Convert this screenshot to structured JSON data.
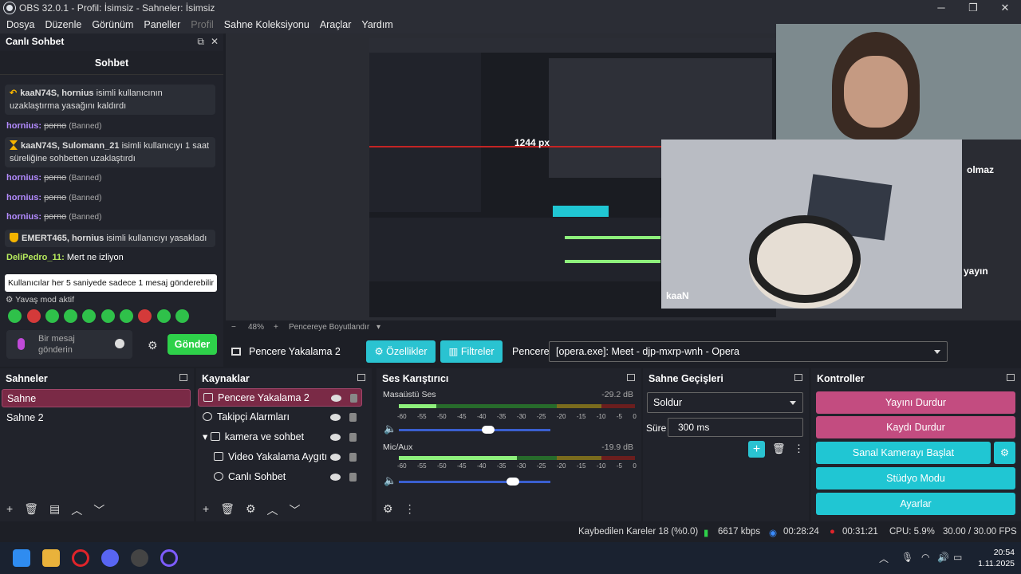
{
  "window": {
    "title": "OBS 32.0.1 - Profil: İsimsiz - Sahneler: İsimsiz"
  },
  "menu": [
    "Dosya",
    "Düzenle",
    "Görünüm",
    "Paneller",
    "Profil",
    "Sahne Koleksiyonu",
    "Araçlar",
    "Yardım"
  ],
  "chat": {
    "dock_title": "Canlı Sohbet",
    "tab": "Sohbet",
    "messages": [
      {
        "user": "kaaN74S, hornius",
        "text": "isimli kullanıcının uzaklaştırma yasağını kaldırdı"
      },
      {
        "user": "hornius:",
        "text": "porno",
        "tag": "(Banned)"
      },
      {
        "user": "kaaN74S, Sulomann_21",
        "text": "isimli kullanıcıyı 1 saat süreliğine sohbetten uzaklaştırdı"
      },
      {
        "user": "hornius:",
        "text": "porno",
        "tag": "(Banned)"
      },
      {
        "user": "hornius:",
        "text": "porno",
        "tag": "(Banned)"
      },
      {
        "user": "hornius:",
        "text": "porno",
        "tag": "(Banned)"
      },
      {
        "user": "EMERT465, hornius",
        "text": "isimli kullanıcıyı yasakladı"
      },
      {
        "user": "DeliPedro_11:",
        "text": "Mert ne izliyon"
      }
    ],
    "slow_notice": "Kullanıcılar her 5 saniyede sadece 1 mesaj gönderebilir",
    "slow_mode": "Yavaş mod aktif",
    "placeholder": "Bir mesaj gönderin",
    "send": "Gönder"
  },
  "preview": {
    "px_label": "1244 px",
    "cam_name": "kaaN",
    "overlay_text_1": "olmaz",
    "overlay_text_2": "yayın",
    "zoom": "48%",
    "fit": "Pencereye Boyutlandır"
  },
  "source_bar": {
    "source": "Pencere Yakalama 2",
    "properties": "Özellikler",
    "filters": "Filtreler",
    "window_label": "Pencere",
    "window_value": "[opera.exe]: Meet - djp-mxrp-wnh - Opera"
  },
  "scenes": {
    "title": "Sahneler",
    "items": [
      "Sahne",
      "Sahne 2"
    ]
  },
  "sources": {
    "title": "Kaynaklar",
    "items": [
      "Pencere Yakalama 2",
      "Takipçi Alarmları",
      "kamera ve sohbet",
      "Video Yakalama Aygıtı",
      "Canlı Sohbet"
    ]
  },
  "mixer": {
    "title": "Ses Karıştırıcı",
    "channels": [
      {
        "name": "Masaüstü Ses",
        "db": "-29.2 dB",
        "level": 0.16,
        "volume": 0.59
      },
      {
        "name": "Mic/Aux",
        "db": "-19.9 dB",
        "level": 0.5,
        "volume": 0.75
      }
    ],
    "ticks": [
      "-60",
      "-55",
      "-50",
      "-45",
      "-40",
      "-35",
      "-30",
      "-25",
      "-20",
      "-15",
      "-10",
      "-5",
      "0"
    ]
  },
  "transitions": {
    "title": "Sahne Geçişleri",
    "type": "Soldur",
    "duration_label": "Süre",
    "duration": "300 ms"
  },
  "controls": {
    "title": "Kontroller",
    "stop_stream": "Yayını Durdur",
    "stop_rec": "Kaydı Durdur",
    "virtual_cam": "Sanal Kamerayı Başlat",
    "studio": "Stüdyo Modu",
    "settings": "Ayarlar"
  },
  "status": {
    "dropped": "Kaybedilen Kareler 18 (%0.0)",
    "bitrate": "6617 kbps",
    "stream_time": "00:28:24",
    "rec_time": "00:31:21",
    "cpu": "CPU: 5.9%",
    "fps": "30.00 / 30.00 FPS"
  },
  "taskbar": {
    "time": "20:54",
    "date": "1.11.2025"
  },
  "colors": {
    "accent": "#20c6d3",
    "pink": "#c34c80",
    "send": "#2ed14a",
    "username": "#b38bff"
  }
}
